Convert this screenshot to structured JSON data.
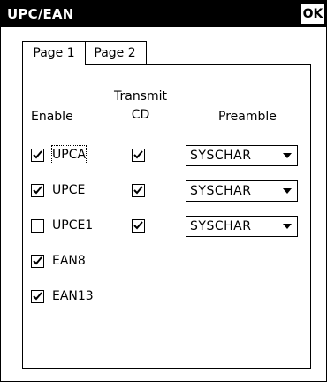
{
  "window": {
    "title": "UPC/EAN",
    "ok_label": "OK"
  },
  "tabs": [
    {
      "label": "Page 1",
      "active": true
    },
    {
      "label": "Page 2",
      "active": false
    }
  ],
  "headers": {
    "enable": "Enable",
    "transmit_cd_line1": "Transmit",
    "transmit_cd_line2": "CD",
    "preamble": "Preamble"
  },
  "symbologies": [
    {
      "label": "UPCA",
      "enabled": true,
      "transmit_cd": true,
      "preamble": "SYSCHAR"
    },
    {
      "label": "UPCE",
      "enabled": true,
      "transmit_cd": true,
      "preamble": "SYSCHAR"
    },
    {
      "label": "UPCE1",
      "enabled": false,
      "transmit_cd": true,
      "preamble": "SYSCHAR"
    },
    {
      "label": "EAN8",
      "enabled": true
    },
    {
      "label": "EAN13",
      "enabled": true
    }
  ]
}
